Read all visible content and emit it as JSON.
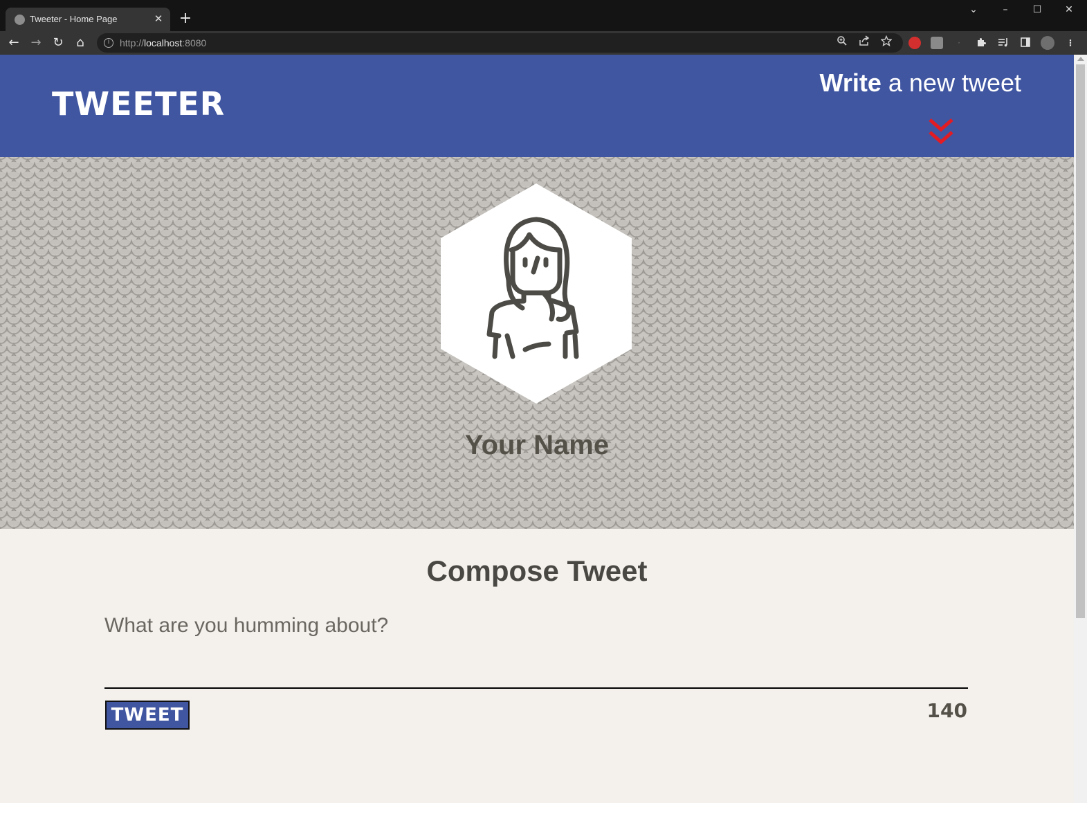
{
  "browser": {
    "tab_title": "Tweeter - Home Page",
    "tab_close": "✕",
    "new_tab": "+",
    "url_scheme": "http://",
    "url_host": "localhost",
    "url_port": ":8080",
    "window_controls": {
      "dropdown": "⌄",
      "minimize": "–",
      "maximize": "☐",
      "close": "✕"
    },
    "nav": {
      "back": "←",
      "forward": "→",
      "reload": "↻",
      "home": "⌂"
    },
    "icons": [
      "zoom-icon",
      "share-icon",
      "bookmark-star-icon",
      "extension-icons",
      "puzzle-icon",
      "media-icon",
      "sidebar-icon",
      "profile-avatar",
      "menu-icon"
    ]
  },
  "header": {
    "logo": "TWEETER",
    "write_bold": "Write",
    "write_rest": " a new tweet",
    "chevron_color": "#e31b23"
  },
  "profile": {
    "name": "Your Name"
  },
  "compose": {
    "title": "Compose Tweet",
    "placeholder": "What are you humming about?",
    "button_label": "TWEET",
    "counter": "140"
  },
  "colors": {
    "header_bg": "#4056a1",
    "page_bg": "#f4f1ed",
    "text": "#545149"
  }
}
